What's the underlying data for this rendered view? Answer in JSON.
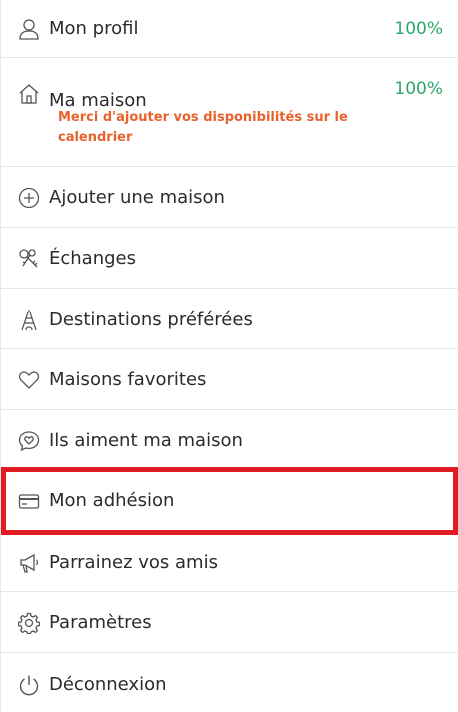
{
  "menu": {
    "items": [
      {
        "label": "Mon profil",
        "icon": "user-icon",
        "percent": "100%"
      },
      {
        "label": "Ma maison",
        "icon": "house-icon",
        "percent": "100%",
        "note": "Merci d'ajouter vos disponibilités sur le calendrier"
      },
      {
        "label": "Ajouter une maison",
        "icon": "plus-circle-icon"
      },
      {
        "label": "Échanges",
        "icon": "keys-icon"
      },
      {
        "label": "Destinations préférées",
        "icon": "eiffel-tower-icon"
      },
      {
        "label": "Maisons favorites",
        "icon": "heart-icon"
      },
      {
        "label": "Ils aiment ma maison",
        "icon": "heart-bubble-icon"
      },
      {
        "label": "Mon adhésion",
        "icon": "credit-card-icon"
      },
      {
        "label": "Parrainez vos amis",
        "icon": "megaphone-icon"
      },
      {
        "label": "Paramètres",
        "icon": "gear-icon"
      },
      {
        "label": "Déconnexion",
        "icon": "power-icon"
      }
    ]
  },
  "colors": {
    "text": "#2b2b2b",
    "percent": "#2aa86a",
    "note": "#e8622c",
    "highlight": "#e01b22",
    "divider": "#e6e6e6",
    "icon": "#555555"
  }
}
